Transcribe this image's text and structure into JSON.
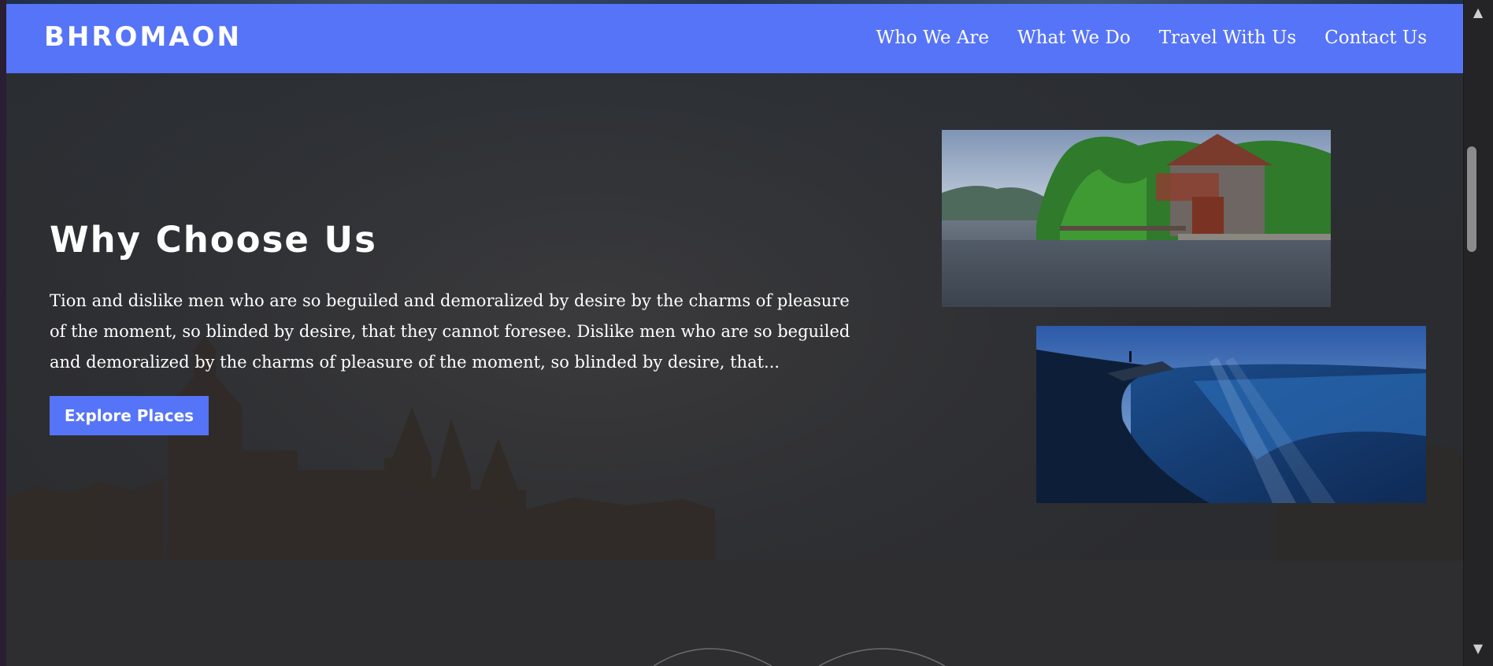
{
  "navbar": {
    "brand": "BHROMAON",
    "links": [
      "Who We Are",
      "What We Do",
      "Travel With Us",
      "Contact Us"
    ]
  },
  "hero": {
    "title": "Why Choose Us",
    "body": "Tion and dislike men who are so beguiled and demoralized by desire by the charms of pleasure of the moment, so blinded by desire, that they cannot foresee. Dislike men who are so beguiled and demoralized by the charms of pleasure of the moment, so blinded by desire, that...",
    "button": "Explore Places"
  },
  "colors": {
    "accent": "#5674f7",
    "background": "#2e2e30",
    "text": "#ffffff"
  },
  "icons": [
    "scroll-up-arrow-icon",
    "scroll-down-arrow-icon"
  ],
  "scrollbar": {
    "up": "▲",
    "down": "▼"
  }
}
